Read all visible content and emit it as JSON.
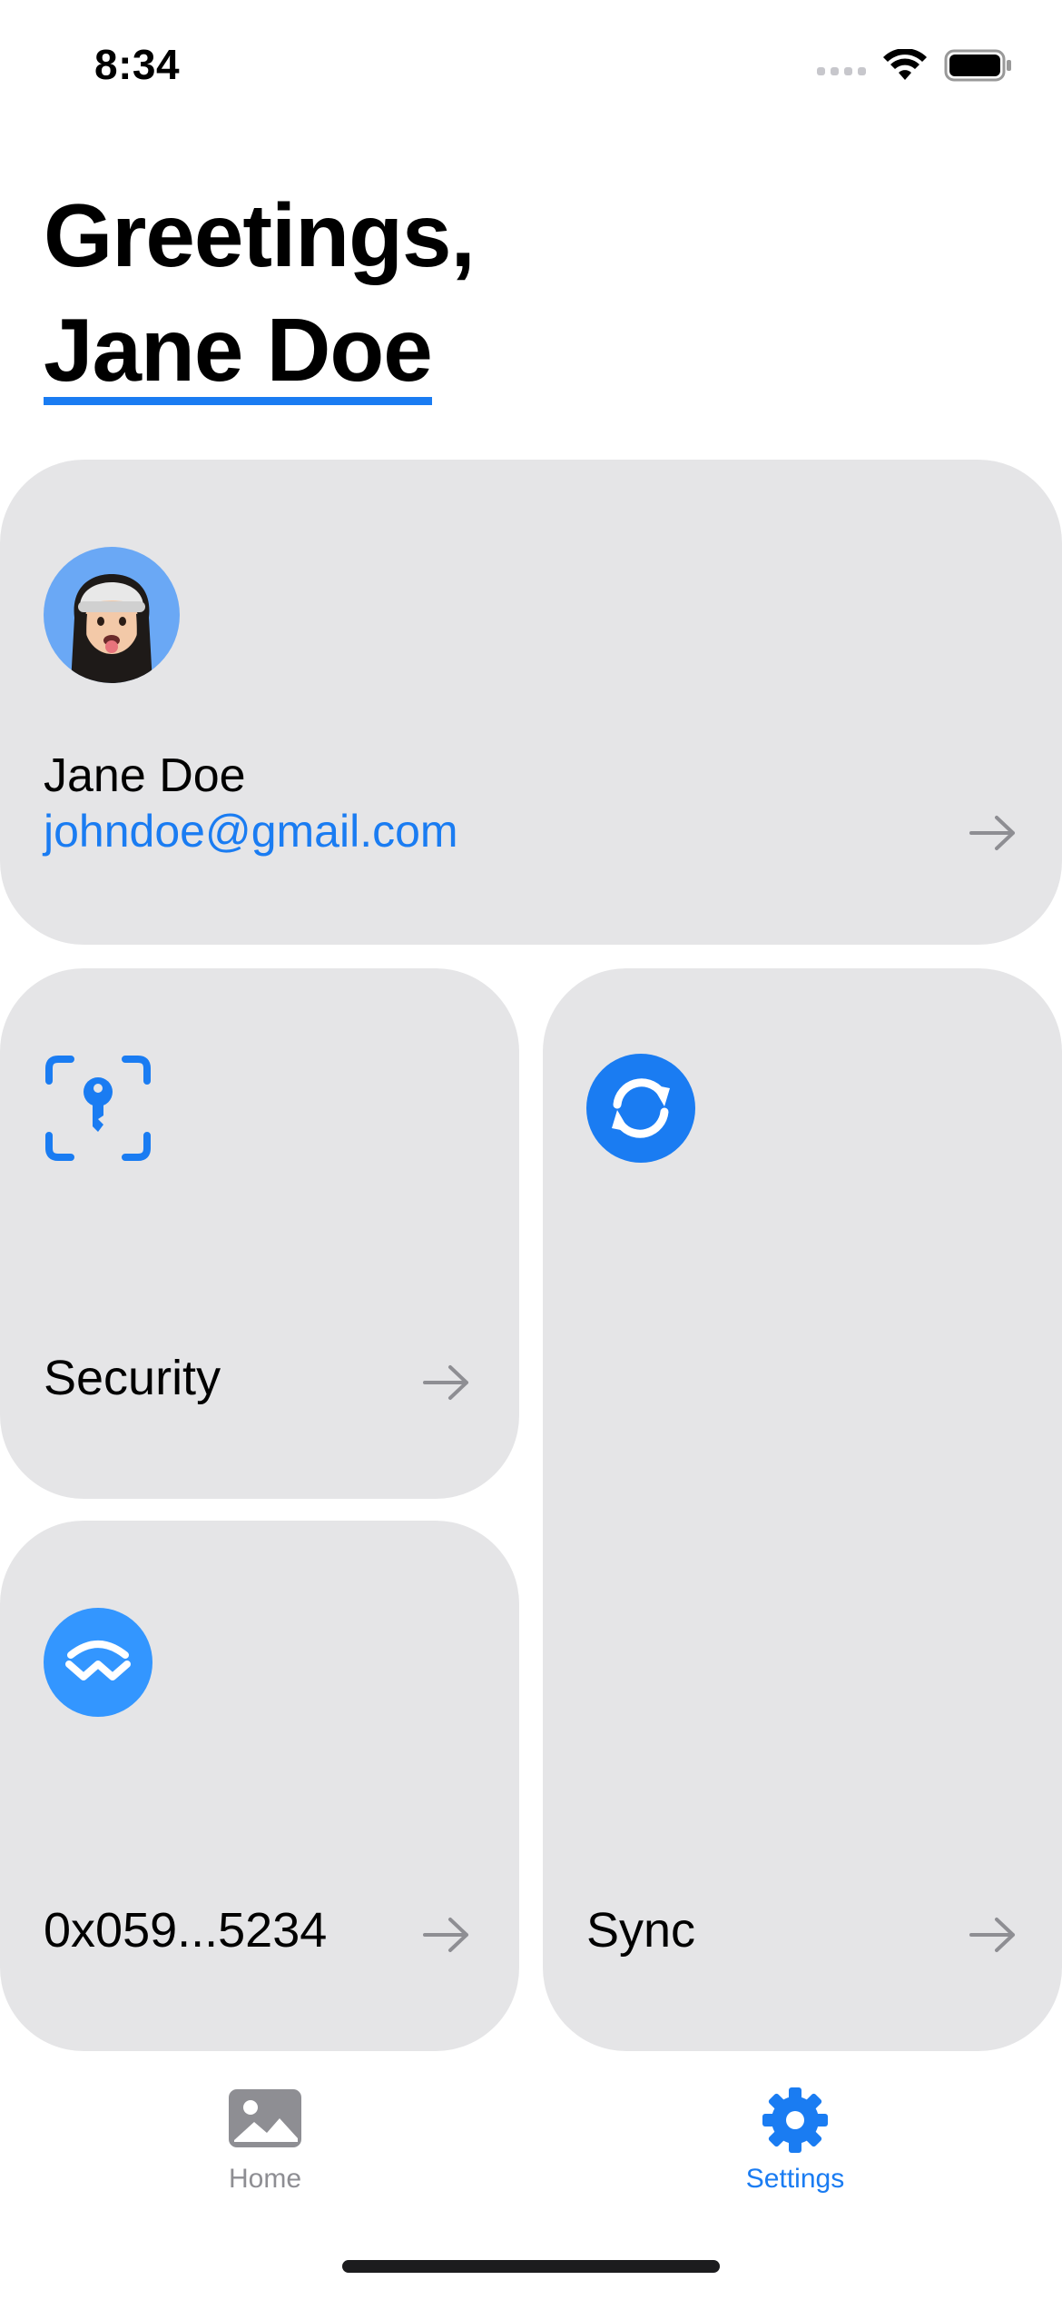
{
  "status_bar": {
    "time": "8:34",
    "icons": [
      "signal-icon",
      "wifi-icon",
      "battery-icon"
    ]
  },
  "greeting": {
    "line1": "Greetings,",
    "name": "Jane Doe"
  },
  "profile": {
    "name": "Jane Doe",
    "email": "johndoe@gmail.com",
    "avatar_icon": "memoji-avatar"
  },
  "cards": {
    "security": {
      "label": "Security",
      "icon": "key-scan-icon"
    },
    "wallet": {
      "label": "0x059...5234",
      "icon": "walletconnect-icon"
    },
    "sync": {
      "label": "Sync",
      "icon": "sync-icon"
    }
  },
  "tab_bar": {
    "items": [
      {
        "label": "Home",
        "icon": "photo-icon",
        "active": false
      },
      {
        "label": "Settings",
        "icon": "gear-icon",
        "active": true
      }
    ]
  },
  "colors": {
    "accent": "#1a7cf2",
    "card_background": "#e5e5e7",
    "inactive": "#8e8e93"
  }
}
